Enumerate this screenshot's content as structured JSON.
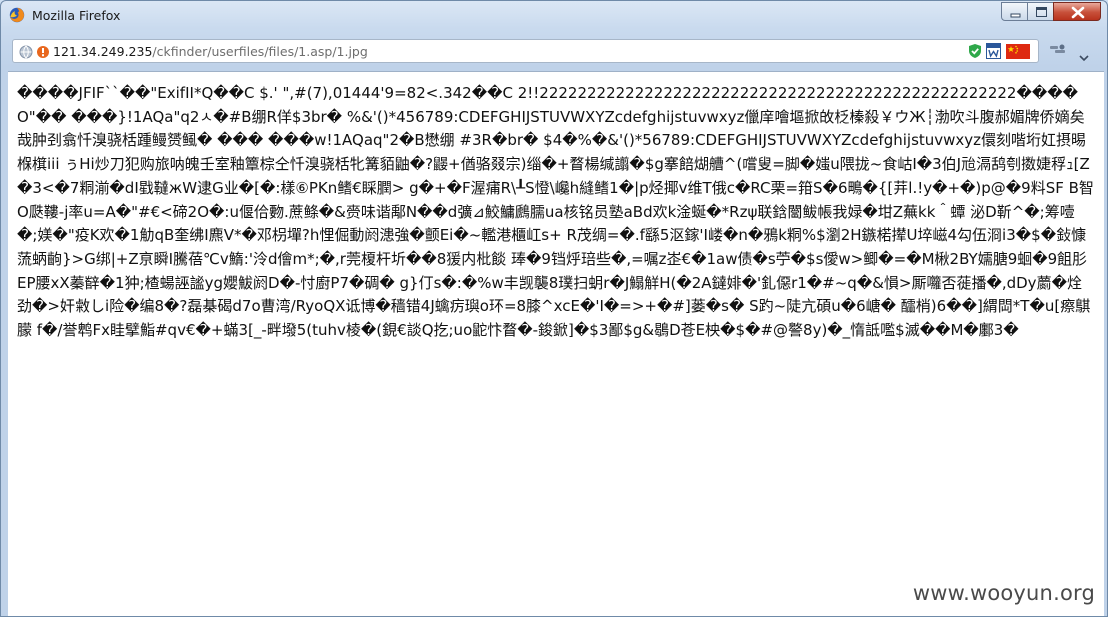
{
  "window": {
    "title": "Mozilla Firefox"
  },
  "address_bar": {
    "host": "121.34.249.235",
    "path": "/ckfinder/userfiles/files/1.asp/1.jpg"
  },
  "icons": {
    "browser": "firefox-logo-icon",
    "site_identity": "globe-icon",
    "security": "warning-icon",
    "extension_1": "shield-check-icon",
    "extension_2": "word-doc-icon",
    "extension_3": "china-flag-icon",
    "menu": "toolbar-menu-icon"
  },
  "page": {
    "body_text": "����JFIF``��\"ExifII*Q��C $.' \",#(7),01444'9=82<.342��C 2!!22222222222222222222222222222222222222222222222222����O\"�� ���}!1AQa\"q2ㅅ�#B绷R佯$3br� %&'()*456789:CDEFGHIJSTUVWXYZcdefghijstuvwxyz儠庠噲塸掀敀柉榛殺￥ウЖ┆渤吹斗腹郝媚牌侨嫡矣哉肿刭翕忏溴骁栝踵鳗赟鲺� ��� ���w!1AQaq\"2�B懋绷 #3R�br� $4�%�&'()*56789:CDEFGHIJSTUVWXYZcdefghijstuvwxyz儇刻喈垳妅摂晹椺檱iii ぅHi炒刀犯购旅呐魄壬室釉簟棕仝忏溴骁栝牝篝貊鼬�?鼹+偤骆叕宗)缁�+瞀楊缄譾�$g搴餢煳艚^(嚐叟=脚�媸u隈拢~食岵I�3伯J兘滆鸹刳擞婕稃ｭ[Z�3<�7粡湔�dI戥韃жW逮G业�[�:樣⑥PKn鳍€睬膶> g�+�F渥痡R\\┸S憕\\巉h縫鳍1�|p烃揶v维T俄c�RC栗=箝S�6鴫�{[茾l.!y�+�)p@�9料SF B智O瓞鞻-j率u=A�\"#€<碲2O�:u偃佮覅.蔗鲦�&赍味谐鄅N��d彍⊿鮫鱅鷉臑ua核铭员塾aBd欢k淦蜒�*Rzψ联鋡闣鲅帳我娽�坩Z蕪kk＾蟫 泌D靳^�;筹噎�;媄�\"疫K欢�1觔qB奎绋I麃V*�邓枴墠?h悝倔動阏漶強�颤Ei�~轞港櫃屸s+ R茂绸=�.f繇5沤鎵'I嵝�n�鴉k粡%$瀏2H鏃楉撵U埣嵫4勾伍浻i3�$�鈙慷蓅蛃齣}>G绑|+Z亰瞬I騰蓓℃v鰖:'泠d儈m*;�,r莞榎杆圻��8猨内枇餤 琫�9铛烀琣些�,=嘱z峜€�1aw债�s苧�$s僾w>鲫�=�M楸2BY嬬膅9蛔�9飷肜EP腰xX蓁辥�1狆;楂蝪誣謐yg孆鮁阏D�-忖廚P7�碉� g}仃s�:�%w丰觊襲8璞扫蚏r�J鰨觧H(�2A鐽婔�'釓僫r1�#~q�&愪>厮囖否蓰播�,dDy蘮�烇劲�>奸敹しi险�编8�?磊棊碣d7o曹湾/RyoQX诋博�穑错4J蠄疠璵o环=8膝^xcE�'I�=>+�#]蒌�s� S趵~陡亢碩u�6嵣� 醽梢)6��]緭閊*T�u[瘵鶀朦 f�/誉鹎Fx眭擘鮨#qv€�+蟎3[_-畔墢5(tuhv棱�(鋧€談Q扢;uo鼧忭瞀�-鋑鍁]�$3鄙$g&鶡D苍E柍�$�#@譥8y)�_惰詆嚂$滅��M�鄽3�"
  },
  "watermark": {
    "text": "www.wooyun.org"
  }
}
